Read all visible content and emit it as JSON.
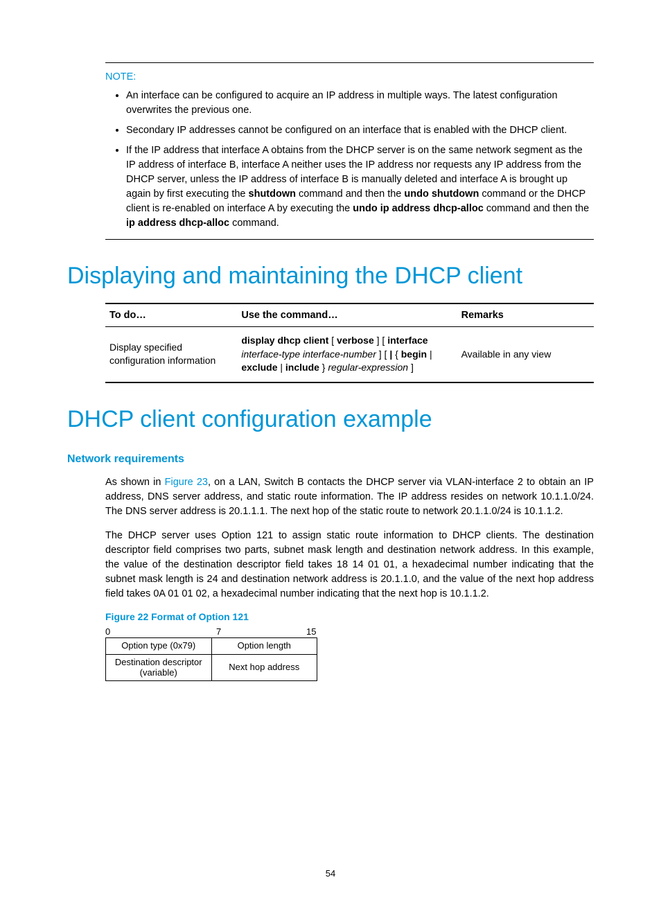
{
  "note": {
    "label": "NOTE:",
    "items": [
      {
        "text": "An interface can be configured to acquire an IP address in multiple ways. The latest configuration overwrites the previous one."
      },
      {
        "text": "Secondary IP addresses cannot be configured on an interface that is enabled with the DHCP client."
      },
      {
        "pre": "If the IP address that interface A obtains from the DHCP server is on the same network segment as the IP address of interface B, interface A neither uses the IP address nor requests any IP address from the DHCP server, unless the IP address of interface B is manually deleted and interface A is brought up again by first executing the ",
        "b1": "shutdown",
        "mid1": " command and then the ",
        "b2": "undo shutdown",
        "mid2": " command or the DHCP client is re-enabled on interface A by executing the ",
        "b3": "undo ip address dhcp-alloc",
        "mid3": " command and then the ",
        "b4": "ip address dhcp-alloc",
        "post": " command."
      }
    ]
  },
  "heading1": "Displaying and maintaining the DHCP client",
  "table": {
    "headers": [
      "To do…",
      "Use the command…",
      "Remarks"
    ],
    "row": {
      "todo": "Display specified configuration information",
      "cmd": {
        "b1": "display dhcp client",
        "t1": " [ ",
        "b2": "verbose",
        "t2": " ] [ ",
        "b3": "interface",
        "t3": " ",
        "i1": "interface-type interface-number",
        "t4": " ] [ ",
        "b4": "|",
        "t5": " { ",
        "b5": "begin",
        "t6": " | ",
        "b6": "exclude",
        "t7": " | ",
        "b7": "include",
        "t8": " } ",
        "i2": "regular-expression",
        "t9": " ]"
      },
      "remarks": "Available in any view"
    }
  },
  "heading2": "DHCP client configuration example",
  "subhead": "Network requirements",
  "para1": {
    "pre": "As shown in ",
    "ref": "Figure 23",
    "post": ", on a LAN, Switch B contacts the DHCP server via VLAN-interface 2 to obtain an IP address, DNS server address, and static route information. The IP address resides on network 10.1.1.0/24. The DNS server address is 20.1.1.1. The next hop of the static route to network 20.1.1.0/24 is 10.1.1.2."
  },
  "para2": "The DHCP server uses Option 121 to assign static route information to DHCP clients. The destination descriptor field comprises two parts, subnet mask length and destination network address. In this example, the value of the destination descriptor field takes 18 14 01 01, a hexadecimal number indicating that the subnet mask length is 24 and destination network address is 20.1.1.0, and the value of the next hop address field takes 0A 01 01 02, a hexadecimal number indicating that the next hop is 10.1.1.2.",
  "figcap": "Figure 22 Format of Option 121",
  "fig": {
    "ruler": {
      "a": "0",
      "b": "7",
      "c": "15"
    },
    "r1c1": "Option type (0x79)",
    "r1c2": "Option length",
    "r2c1a": "Destination descriptor",
    "r2c1b": "(variable)",
    "r2c2": "Next hop address"
  },
  "pagenum": "54"
}
